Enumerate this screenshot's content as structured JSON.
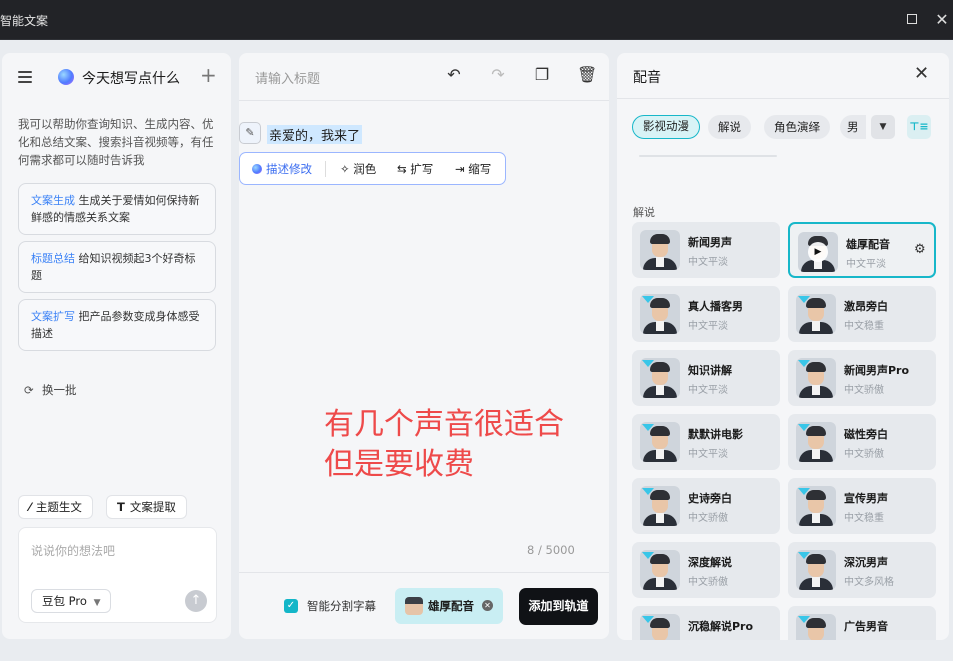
{
  "window": {
    "title": "智能文案"
  },
  "left": {
    "heading": "今天想写点什么",
    "intro": "我可以帮助你查询知识、生成内容、优化和总结文案、搜索抖音视频等，有任何需求都可以随时告诉我",
    "suggestions": [
      {
        "tag": "文案生成",
        "text": "生成关于爱情如何保持新鲜感的情感关系文案"
      },
      {
        "tag": "标题总结",
        "text": "给知识视频起3个好奇标题"
      },
      {
        "tag": "文案扩写",
        "text": "把产品参数变成身体感受描述"
      }
    ],
    "refresh": "换一批",
    "chips": {
      "theme": "主题生文",
      "extract": "文案提取"
    },
    "input_placeholder": "说说你的想法吧",
    "model": "豆包 Pro"
  },
  "editor": {
    "title_placeholder": "请输入标题",
    "content": "亲爱的，我来了",
    "actions": [
      "描述修改",
      "润色",
      "扩写",
      "缩写"
    ],
    "annotation": [
      "有几个声音很适合",
      "但是要收费"
    ],
    "counter": "8 / 5000",
    "subtitle_toggle": "智能分割字幕",
    "selected_voice": "雄厚配音",
    "add_button": "添加到轨道"
  },
  "voice": {
    "title": "配音",
    "categories": [
      "影视动漫",
      "解说",
      "角色演绎",
      "男"
    ],
    "section": "解说",
    "items": [
      {
        "name": "新闻男声",
        "desc": "中文平淡",
        "premium": false
      },
      {
        "name": "雄厚配音",
        "desc": "中文平淡",
        "premium": false,
        "selected": true
      },
      {
        "name": "真人播客男",
        "desc": "中文平淡",
        "premium": true
      },
      {
        "name": "激昂旁白",
        "desc": "中文稳重",
        "premium": true
      },
      {
        "name": "知识讲解",
        "desc": "中文平淡",
        "premium": true
      },
      {
        "name": "新闻男声Pro",
        "desc": "中文骄傲",
        "premium": true
      },
      {
        "name": "默默讲电影",
        "desc": "中文平淡",
        "premium": true
      },
      {
        "name": "磁性旁白",
        "desc": "中文骄傲",
        "premium": true
      },
      {
        "name": "史诗旁白",
        "desc": "中文骄傲",
        "premium": true
      },
      {
        "name": "宣传男声",
        "desc": "中文稳重",
        "premium": true
      },
      {
        "name": "深度解说",
        "desc": "中文骄傲",
        "premium": true
      },
      {
        "name": "深沉男声",
        "desc": "中文多风格",
        "premium": true
      },
      {
        "name": "沉稳解说Pro",
        "desc": "中文平淡",
        "premium": true
      },
      {
        "name": "广告男音",
        "desc": "中文平淡",
        "premium": true
      }
    ]
  },
  "colors": {
    "accent": "#17b7c9",
    "annotation": "#ee4a4a",
    "highlight": "#cfe8ff"
  }
}
